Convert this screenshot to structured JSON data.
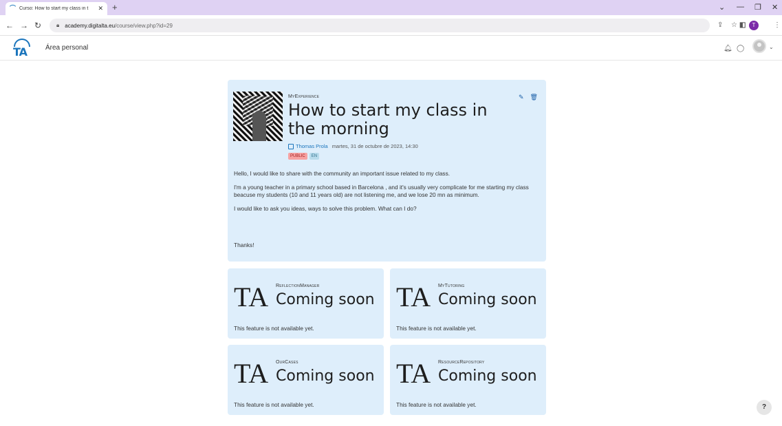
{
  "browser": {
    "tab_title": "Curso: How to start my class in t",
    "tab_close": "✕",
    "new_tab": "+",
    "url_host": "academy.digitalta.eu",
    "url_path": "/course/view.php?id=29",
    "profile_initial": "T"
  },
  "header": {
    "logo_text": "TA",
    "area_personal": "Área personal"
  },
  "post": {
    "eyebrow": "MyExperience",
    "title": "How to start my class in the morning",
    "author": "Thomas Prola",
    "date": "martes, 31 de octubre de 2023, 14:30",
    "badge_public": "PUBLIC",
    "badge_lang": "EN",
    "paragraphs": [
      "Hello, I would like to share with the community an important issue related to my class.",
      "I'm a young teacher in a primary school based in Barcelona , and it's usually very complicate for me starting my class beacuse my students (10 and 11 years old) are not listening me, and we lose 20 mn as minimum.",
      "I would like to ask you ideas, ways to solve this problem. What can I do?"
    ],
    "thanks": "Thanks!"
  },
  "features": [
    {
      "eyebrow": "ReflectionManager",
      "logo": "TA",
      "title": "Coming soon",
      "desc": "This feature is not available yet."
    },
    {
      "eyebrow": "MyTutoring",
      "logo": "TA",
      "title": "Coming soon",
      "desc": "This feature is not available yet."
    },
    {
      "eyebrow": "OurCases",
      "logo": "TA",
      "title": "Coming soon",
      "desc": "This feature is not available yet."
    },
    {
      "eyebrow": "ResourceRepository",
      "logo": "TA",
      "title": "Coming soon",
      "desc": "This feature is not available yet."
    }
  ],
  "help_label": "?",
  "colors": {
    "tabbar": "#dfd2f3",
    "card_bg": "#deeefb",
    "brand_blue": "#1b75bc",
    "badge_public": "#f7a2a2",
    "badge_lang": "#b9dcec"
  }
}
